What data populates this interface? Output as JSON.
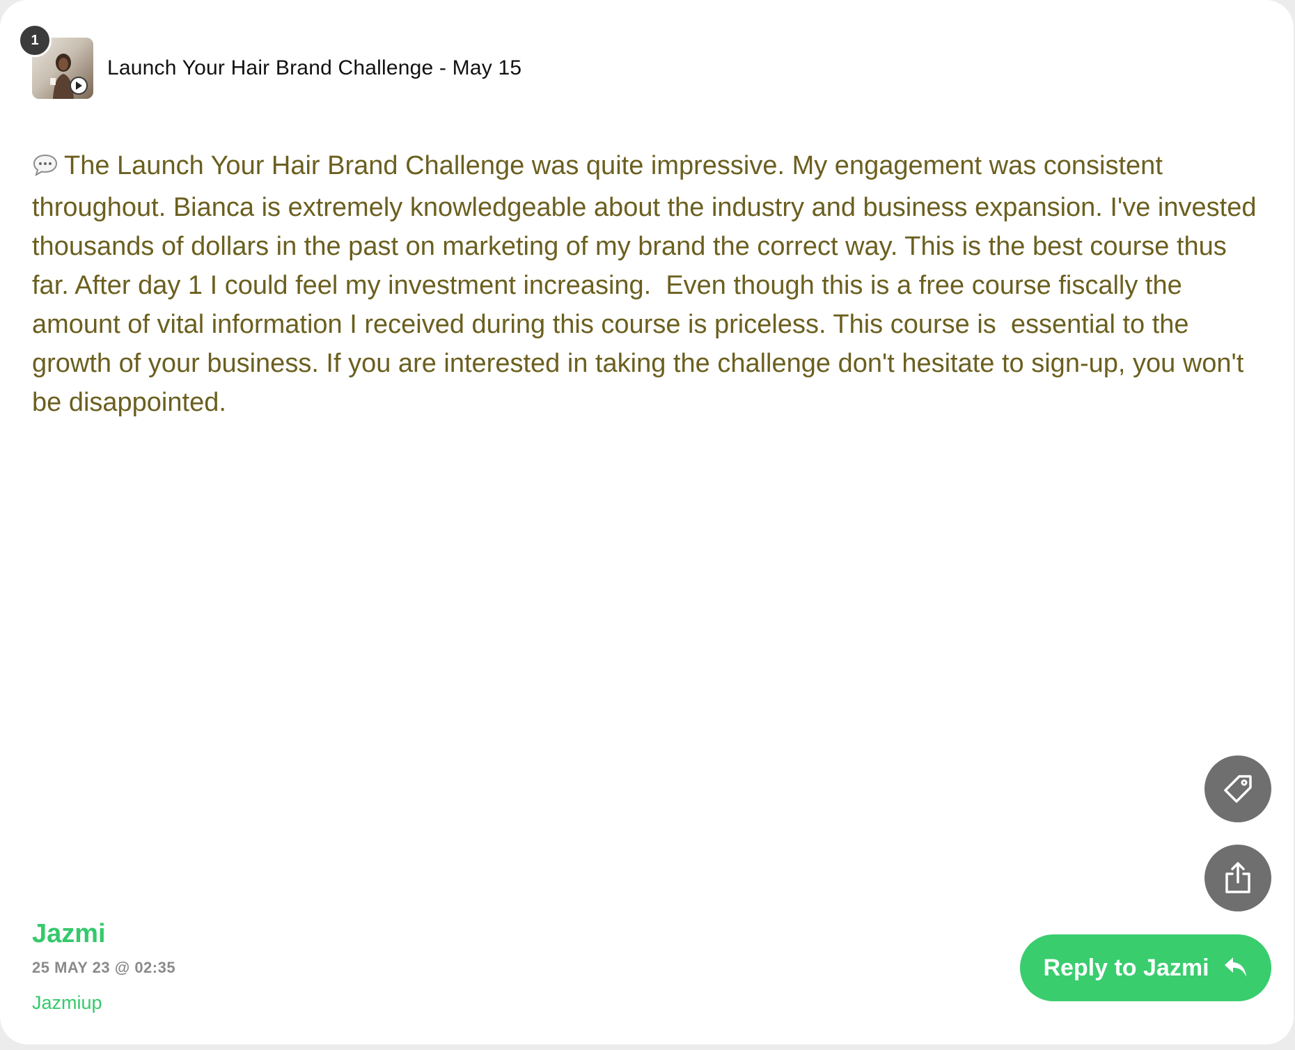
{
  "header": {
    "count": "1",
    "title": "Launch Your Hair Brand Challenge - May 15"
  },
  "review": {
    "text": "The Launch Your Hair Brand Challenge was quite impressive. My engagement was consistent throughout. Bianca is extremely knowledgeable about the industry and business expansion. I've invested thousands of dollars in the past on marketing of my brand the correct way. This is the best course thus far. After day 1 I could feel my investment increasing.  Even though this is a free course fiscally the amount of vital information I received during this course is priceless. This course is  essential to the growth of your business. If you are interested in taking the challenge don't hesitate to sign-up, you won't be disappointed."
  },
  "author": {
    "name": "Jazmi",
    "date": "25 MAY 23 @ 02:35",
    "handle": "Jazmiup"
  },
  "actions": {
    "reply_label": "Reply to Jazmi",
    "tag_icon": "tag-icon",
    "share_icon": "share-icon"
  },
  "colors": {
    "accent": "#39cd6e",
    "body_text": "#6b5f1f",
    "icon_button": "#6f6f6f"
  }
}
